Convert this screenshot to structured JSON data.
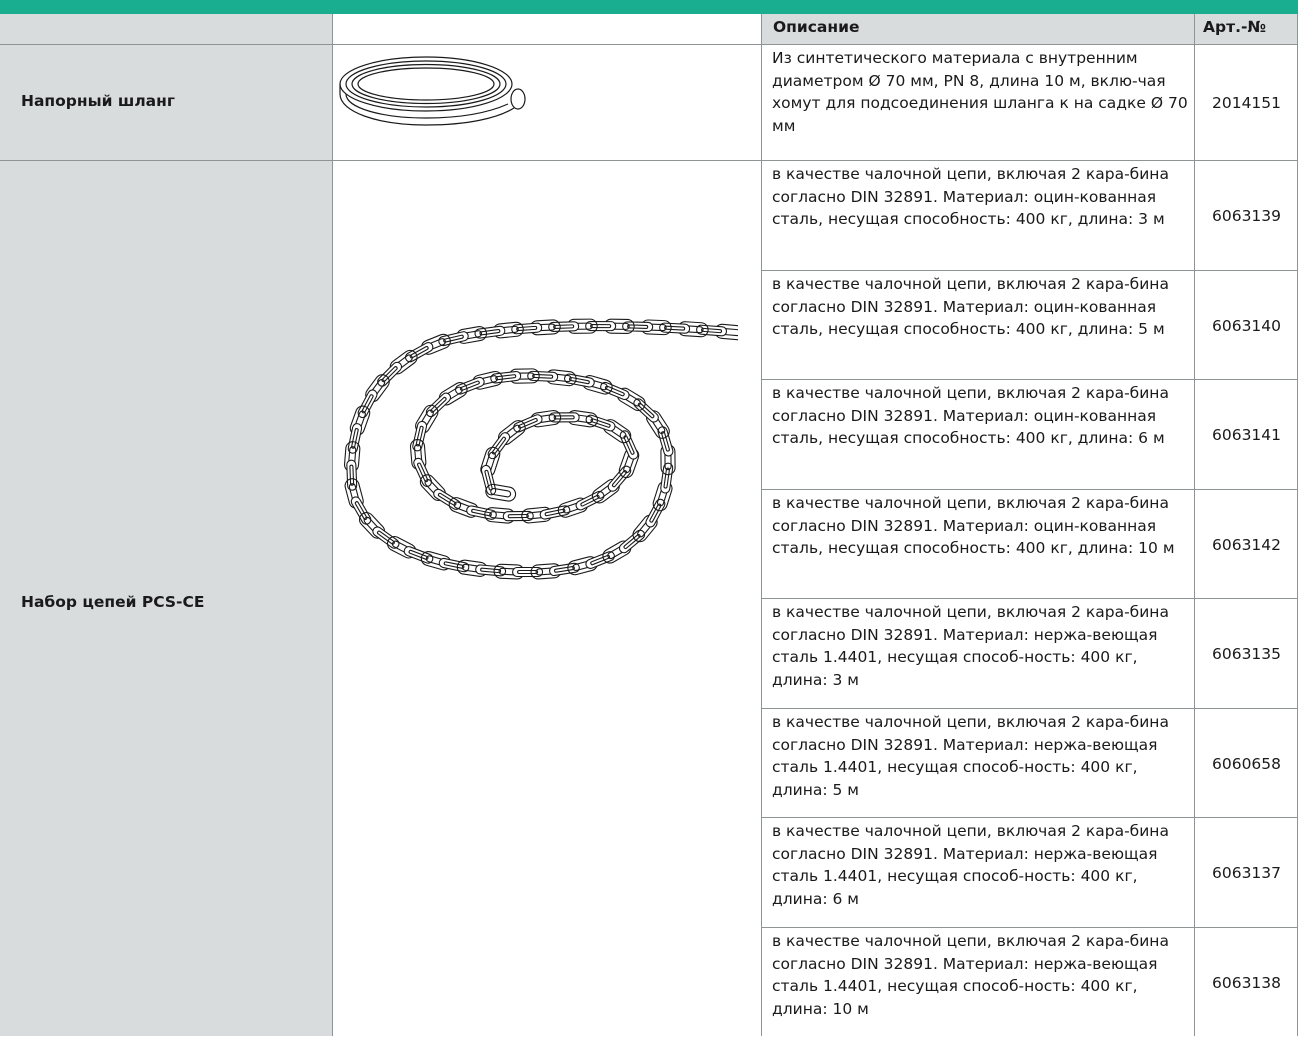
{
  "table": {
    "headers": {
      "description": "Описание",
      "article": "Арт.-№"
    },
    "products": [
      {
        "name": "Напорный шланг",
        "image": "hose-coil-illustration",
        "rows": [
          {
            "description": "Из синтетического материала с внутренним диаметром Ø 70 мм, PN 8, длина 10 м, вклю-чая хомут для подсоединения шланга к на садке Ø 70 мм",
            "article": "2014151"
          }
        ]
      },
      {
        "name": "Набор цепей PCS-CE",
        "image": "chain-illustration",
        "rows": [
          {
            "description": "в качестве чалочной цепи, включая 2 кара-бина согласно DIN 32891. Материал: оцин-кованная сталь, несущая способность: 400 кг, длина: 3 м",
            "article": "6063139"
          },
          {
            "description": "в качестве чалочной цепи, включая 2 кара-бина согласно DIN 32891. Материал: оцин-кованная сталь, несущая способность: 400 кг, длина: 5 м",
            "article": "6063140"
          },
          {
            "description": "в качестве чалочной цепи, включая 2 кара-бина согласно DIN 32891. Материал: оцин-кованная сталь, несущая способность: 400 кг, длина: 6 м",
            "article": "6063141"
          },
          {
            "description": "в качестве чалочной цепи, включая 2 кара-бина согласно DIN 32891. Материал: оцин-кованная сталь, несущая способность: 400 кг, длина: 10 м",
            "article": "6063142"
          },
          {
            "description": "в качестве чалочной цепи, включая 2 кара-бина согласно DIN 32891. Материал: нержа-веющая сталь 1.4401, несущая способ-ность: 400 кг, длина: 3 м",
            "article": "6063135"
          },
          {
            "description": "в качестве чалочной цепи, включая 2 кара-бина согласно DIN 32891. Материал: нержа-веющая сталь 1.4401, несущая способ-ность: 400 кг, длина: 5 м",
            "article": "6060658"
          },
          {
            "description": "в качестве чалочной цепи, включая 2 кара-бина согласно DIN 32891. Материал: нержа-веющая сталь 1.4401, несущая способ-ность: 400 кг, длина: 6 м",
            "article": "6063137"
          },
          {
            "description": "в качестве чалочной цепи, включая 2 кара-бина согласно DIN 32891. Материал: нержа-веющая сталь 1.4401, несущая способ-ность: 400 кг, длина: 10 м",
            "article": "6063138"
          }
        ]
      }
    ]
  },
  "colors": {
    "accent_bar": "#1aae91",
    "header_fill": "#d9dcdd",
    "label_column_fill": "#d9dcdd"
  }
}
